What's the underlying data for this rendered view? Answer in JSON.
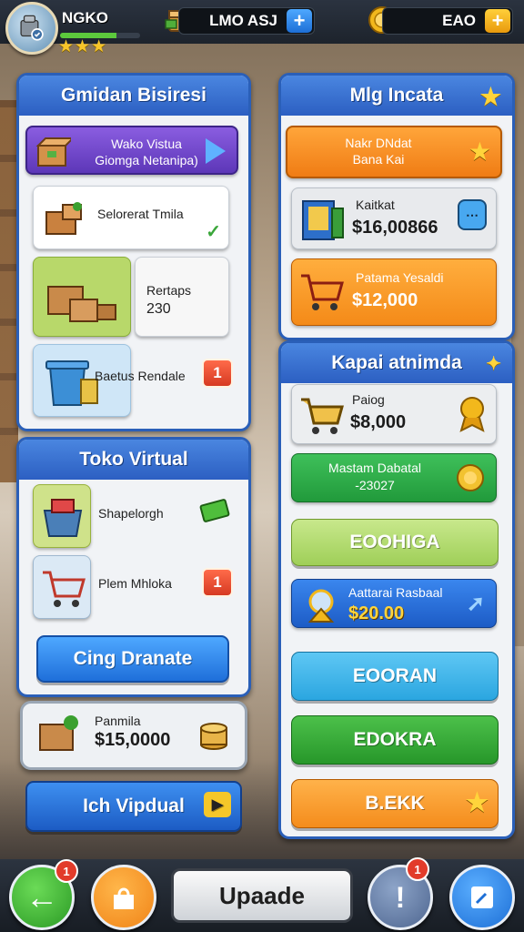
{
  "player": {
    "name": "NGKO",
    "stars": "★★★",
    "xp_fraction": 0.7
  },
  "resources": [
    {
      "value": "LMO ASJ",
      "icon": "cash-box-icon",
      "plus": "+"
    },
    {
      "value": "EAO",
      "icon": "gold-coin-icon",
      "plus": "+"
    }
  ],
  "left_panel": {
    "title": "Gmidan Bisiresi",
    "banner": {
      "line1": "Wako Vistua",
      "line2": "Giomga Netanipa)"
    },
    "card1": {
      "label": "Selorerat Tmila"
    },
    "card2": {
      "label": "Rertaps",
      "value": "230"
    },
    "card3": {
      "label": "Baetus Rendale",
      "badge": "1"
    }
  },
  "virtual_panel": {
    "title": "Toko Virtual",
    "item1": {
      "label": "Shapelorgh"
    },
    "item2": {
      "label": "Plem Mhloka",
      "badge": "1"
    },
    "button": "Cing Dranate"
  },
  "small_card": {
    "label": "Panmila",
    "amount": "$15,0000"
  },
  "left_bottom_button": "Ich Vipdual",
  "right_panel": {
    "title": "Mlg Incata",
    "orange_card": {
      "line1": "Nakr DNdat",
      "line2": "Bana Kai"
    },
    "card1": {
      "label": "Kaitkat",
      "amount": "$16,00866"
    },
    "card2": {
      "label": "Patama Yesaldi",
      "amount": "$12,000"
    }
  },
  "right_panel2": {
    "title": "Kapai atnimda",
    "card1": {
      "label": "Paiog",
      "amount": "$8,000"
    },
    "card2": {
      "line1": "Mastam Dabatal",
      "line2": "-23027"
    },
    "btn1": "EOOHIGA",
    "card3": {
      "label": "Aattarai Rasbaal",
      "amount": "$20.00"
    },
    "btn2": "EOORAN",
    "btn3": "EDOKRA",
    "btn4": "B.EKK"
  },
  "bottom_nav": {
    "upgrade_label": "Upaade",
    "badge_left": "1",
    "badge_right": "1"
  }
}
